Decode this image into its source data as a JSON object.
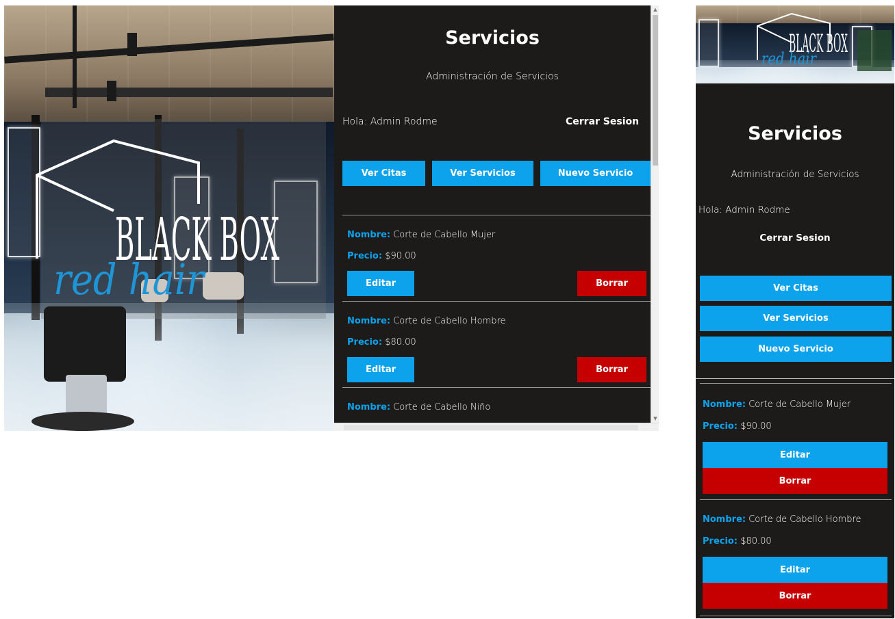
{
  "brand": {
    "logo_line1": "BLACK BOX",
    "logo_line2": "red hair"
  },
  "page": {
    "title": "Servicios",
    "subtitle": "Administración de Servicios"
  },
  "user": {
    "greeting": "Hola: Admin Rodme",
    "logout_label": "Cerrar Sesion"
  },
  "nav": {
    "view_appointments": "Ver Citas",
    "view_services": "Ver Servicios",
    "new_service": "Nuevo Servicio"
  },
  "labels": {
    "name": "Nombre:",
    "price": "Precio:",
    "edit": "Editar",
    "delete": "Borrar"
  },
  "services": [
    {
      "name": "Corte de Cabello Mujer",
      "price": "$90.00"
    },
    {
      "name": "Corte de Cabello Hombre",
      "price": "$80.00"
    },
    {
      "name": "Corte de Cabello Niño",
      "price": ""
    }
  ],
  "colors": {
    "accent": "#0da2ec",
    "danger": "#c60000",
    "panel_bg": "#1c1b19"
  }
}
